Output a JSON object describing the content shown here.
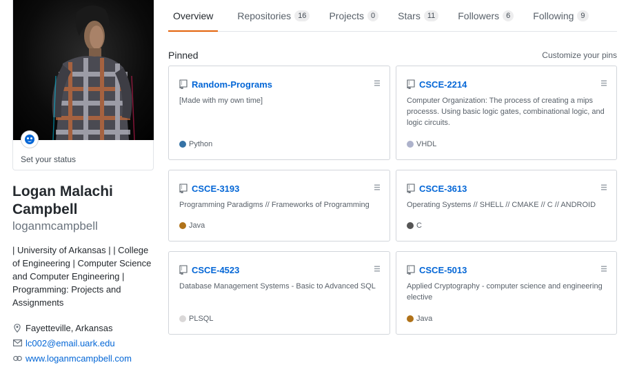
{
  "profile": {
    "status_text": "Set your status",
    "full_name": "Logan Malachi Campbell",
    "login": "loganmcampbell",
    "bio": "| University of Arkansas | | College of Engineering | Computer Science and Computer Engineering | Programming: Projects and Assignments",
    "location": "Fayetteville, Arkansas",
    "email": "lc002@email.uark.edu",
    "website": "www.loganmcampbell.com"
  },
  "tabs": [
    {
      "label": "Overview",
      "count": null
    },
    {
      "label": "Repositories",
      "count": "16"
    },
    {
      "label": "Projects",
      "count": "0"
    },
    {
      "label": "Stars",
      "count": "11"
    },
    {
      "label": "Followers",
      "count": "6"
    },
    {
      "label": "Following",
      "count": "9"
    }
  ],
  "pinned": {
    "title": "Pinned",
    "customize_label": "Customize your pins",
    "repos": [
      {
        "name": "Random-Programs",
        "description": "[Made with my own time]",
        "language": "Python",
        "lang_color": "#3572A5"
      },
      {
        "name": "CSCE-2214",
        "description": "Computer Organization: The process of creating a mips processs. Using basic logic gates, combinational logic, and logic circuits.",
        "language": "VHDL",
        "lang_color": "#adb2cb"
      },
      {
        "name": "CSCE-3193",
        "description": "Programming Paradigms // Frameworks of Programming",
        "language": "Java",
        "lang_color": "#b07219"
      },
      {
        "name": "CSCE-3613",
        "description": "Operating Systems // SHELL // CMAKE // C // ANDROID",
        "language": "C",
        "lang_color": "#555555"
      },
      {
        "name": "CSCE-4523",
        "description": "Database Management Systems - Basic to Advanced SQL",
        "language": "PLSQL",
        "lang_color": "#dad8d8"
      },
      {
        "name": "CSCE-5013",
        "description": "Applied Cryptography - computer science and engineering elective",
        "language": "Java",
        "lang_color": "#b07219"
      }
    ]
  },
  "colors": {
    "accent": "#e36209",
    "link": "#0366d6"
  }
}
